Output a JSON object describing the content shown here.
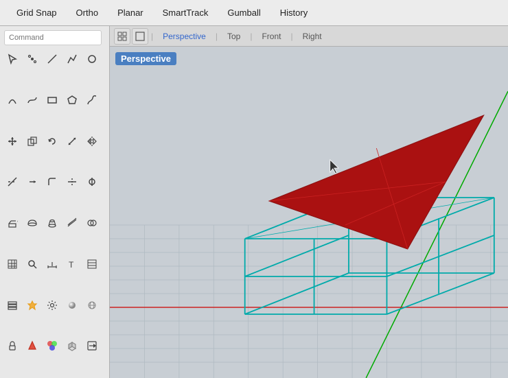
{
  "menuBar": {
    "items": [
      "Grid Snap",
      "Ortho",
      "Planar",
      "SmartTrack",
      "Gumball",
      "History"
    ]
  },
  "commandInput": {
    "placeholder": "Command"
  },
  "viewportTabs": {
    "active": "Perspective",
    "tabs": [
      "Perspective",
      "Top",
      "Front",
      "Right"
    ]
  },
  "perspectiveLabel": "Perspective",
  "toolbar": {
    "tools": [
      {
        "name": "pointer",
        "icon": "↖"
      },
      {
        "name": "point",
        "icon": "·"
      },
      {
        "name": "line",
        "icon": "╱"
      },
      {
        "name": "polyline",
        "icon": "⌒"
      },
      {
        "name": "circle",
        "icon": "○"
      },
      {
        "name": "arc",
        "icon": "◜"
      },
      {
        "name": "curve",
        "icon": "∿"
      },
      {
        "name": "rectangle",
        "icon": "▭"
      },
      {
        "name": "polygon",
        "icon": "⬡"
      },
      {
        "name": "freeform",
        "icon": "✏"
      },
      {
        "name": "move",
        "icon": "✥"
      },
      {
        "name": "copy",
        "icon": "⧉"
      },
      {
        "name": "rotate",
        "icon": "↻"
      },
      {
        "name": "scale",
        "icon": "⤢"
      },
      {
        "name": "mirror",
        "icon": "⊣"
      },
      {
        "name": "trim",
        "icon": "✂"
      },
      {
        "name": "extend",
        "icon": "↔"
      },
      {
        "name": "fillet",
        "icon": "⌒"
      },
      {
        "name": "split",
        "icon": "⊘"
      },
      {
        "name": "join",
        "icon": "⊕"
      },
      {
        "name": "extrude",
        "icon": "⬆"
      },
      {
        "name": "revolve",
        "icon": "↺"
      },
      {
        "name": "loft",
        "icon": "⬛"
      },
      {
        "name": "sweep",
        "icon": "⊂"
      },
      {
        "name": "boolean",
        "icon": "⊞"
      },
      {
        "name": "mesh",
        "icon": "⬦"
      },
      {
        "name": "analyze",
        "icon": "⊡"
      },
      {
        "name": "dimension",
        "icon": "↕"
      },
      {
        "name": "text",
        "icon": "T"
      },
      {
        "name": "hatch",
        "icon": "▤"
      },
      {
        "name": "layer",
        "icon": "≡"
      },
      {
        "name": "properties",
        "icon": "ℹ"
      },
      {
        "name": "render",
        "icon": "◈"
      },
      {
        "name": "zoom",
        "icon": "⌕"
      },
      {
        "name": "pan",
        "icon": "✋"
      },
      {
        "name": "orbit",
        "icon": "⊙"
      },
      {
        "name": "lock",
        "icon": "🔒"
      },
      {
        "name": "snap",
        "icon": "⊛"
      },
      {
        "name": "cage",
        "icon": "⬚"
      },
      {
        "name": "gumball2",
        "icon": "⊕"
      }
    ]
  }
}
